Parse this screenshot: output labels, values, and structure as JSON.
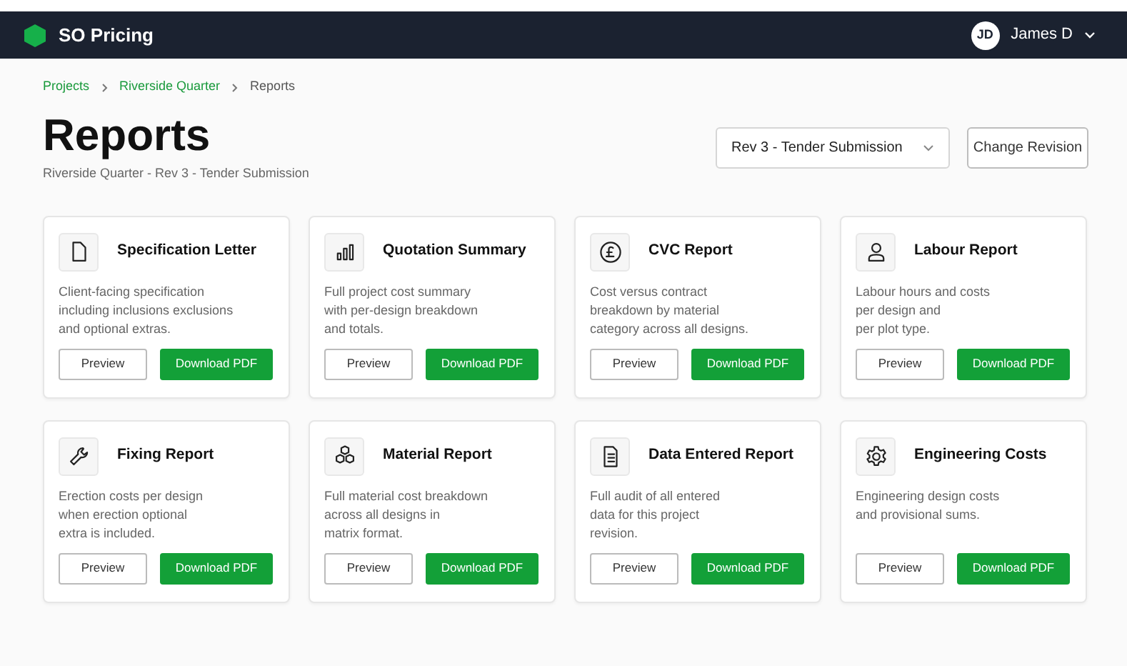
{
  "app": {
    "name": "SO Pricing"
  },
  "user": {
    "initials": "JD",
    "name": "James D"
  },
  "breadcrumb": [
    {
      "label": "Projects",
      "link": true
    },
    {
      "label": "Riverside Quarter",
      "link": true
    },
    {
      "label": "Reports",
      "link": false
    }
  ],
  "page": {
    "title": "Reports",
    "subtitle": "Riverside Quarter - Rev 3 - Tender Submission"
  },
  "revision_select": {
    "value": "Rev 3 - Tender Submission"
  },
  "change_revision_button": "Change Revision",
  "reports": [
    {
      "kind": "document",
      "title": "Specification Letter",
      "description": "Client-facing specification\nincluding inclusions exclusions\nand optional extras.",
      "preview": "Preview",
      "download": "Download PDF"
    },
    {
      "kind": "bars",
      "title": "Quotation Summary",
      "description": "Full project cost summary\nwith per-design breakdown\nand totals.",
      "preview": "Preview",
      "download": "Download PDF"
    },
    {
      "kind": "pound",
      "title": "CVC Report",
      "description": "Cost versus contract\nbreakdown by material\ncategory across all designs.",
      "preview": "Preview",
      "download": "Download PDF"
    },
    {
      "kind": "person",
      "title": "Labour Report",
      "description": "Labour hours and costs\nper design and\nper plot type.",
      "preview": "Preview",
      "download": "Download PDF"
    },
    {
      "kind": "wrench",
      "title": "Fixing Report",
      "description": "Erection costs per design\nwhen erection optional\nextra is included.",
      "preview": "Preview",
      "download": "Download PDF"
    },
    {
      "kind": "cubes",
      "title": "Material Report",
      "description": "Full material cost breakdown\nacross all designs in\nmatrix format.",
      "preview": "Preview",
      "download": "Download PDF"
    },
    {
      "kind": "text-document",
      "title": "Data Entered Report",
      "description": "Full audit of all entered\ndata for this project\nrevision.",
      "preview": "Preview",
      "download": "Download PDF"
    },
    {
      "kind": "gear",
      "title": "Engineering Costs",
      "description": "Engineering design costs\nand provisional sums.",
      "preview": "Preview",
      "download": "Download PDF"
    }
  ]
}
